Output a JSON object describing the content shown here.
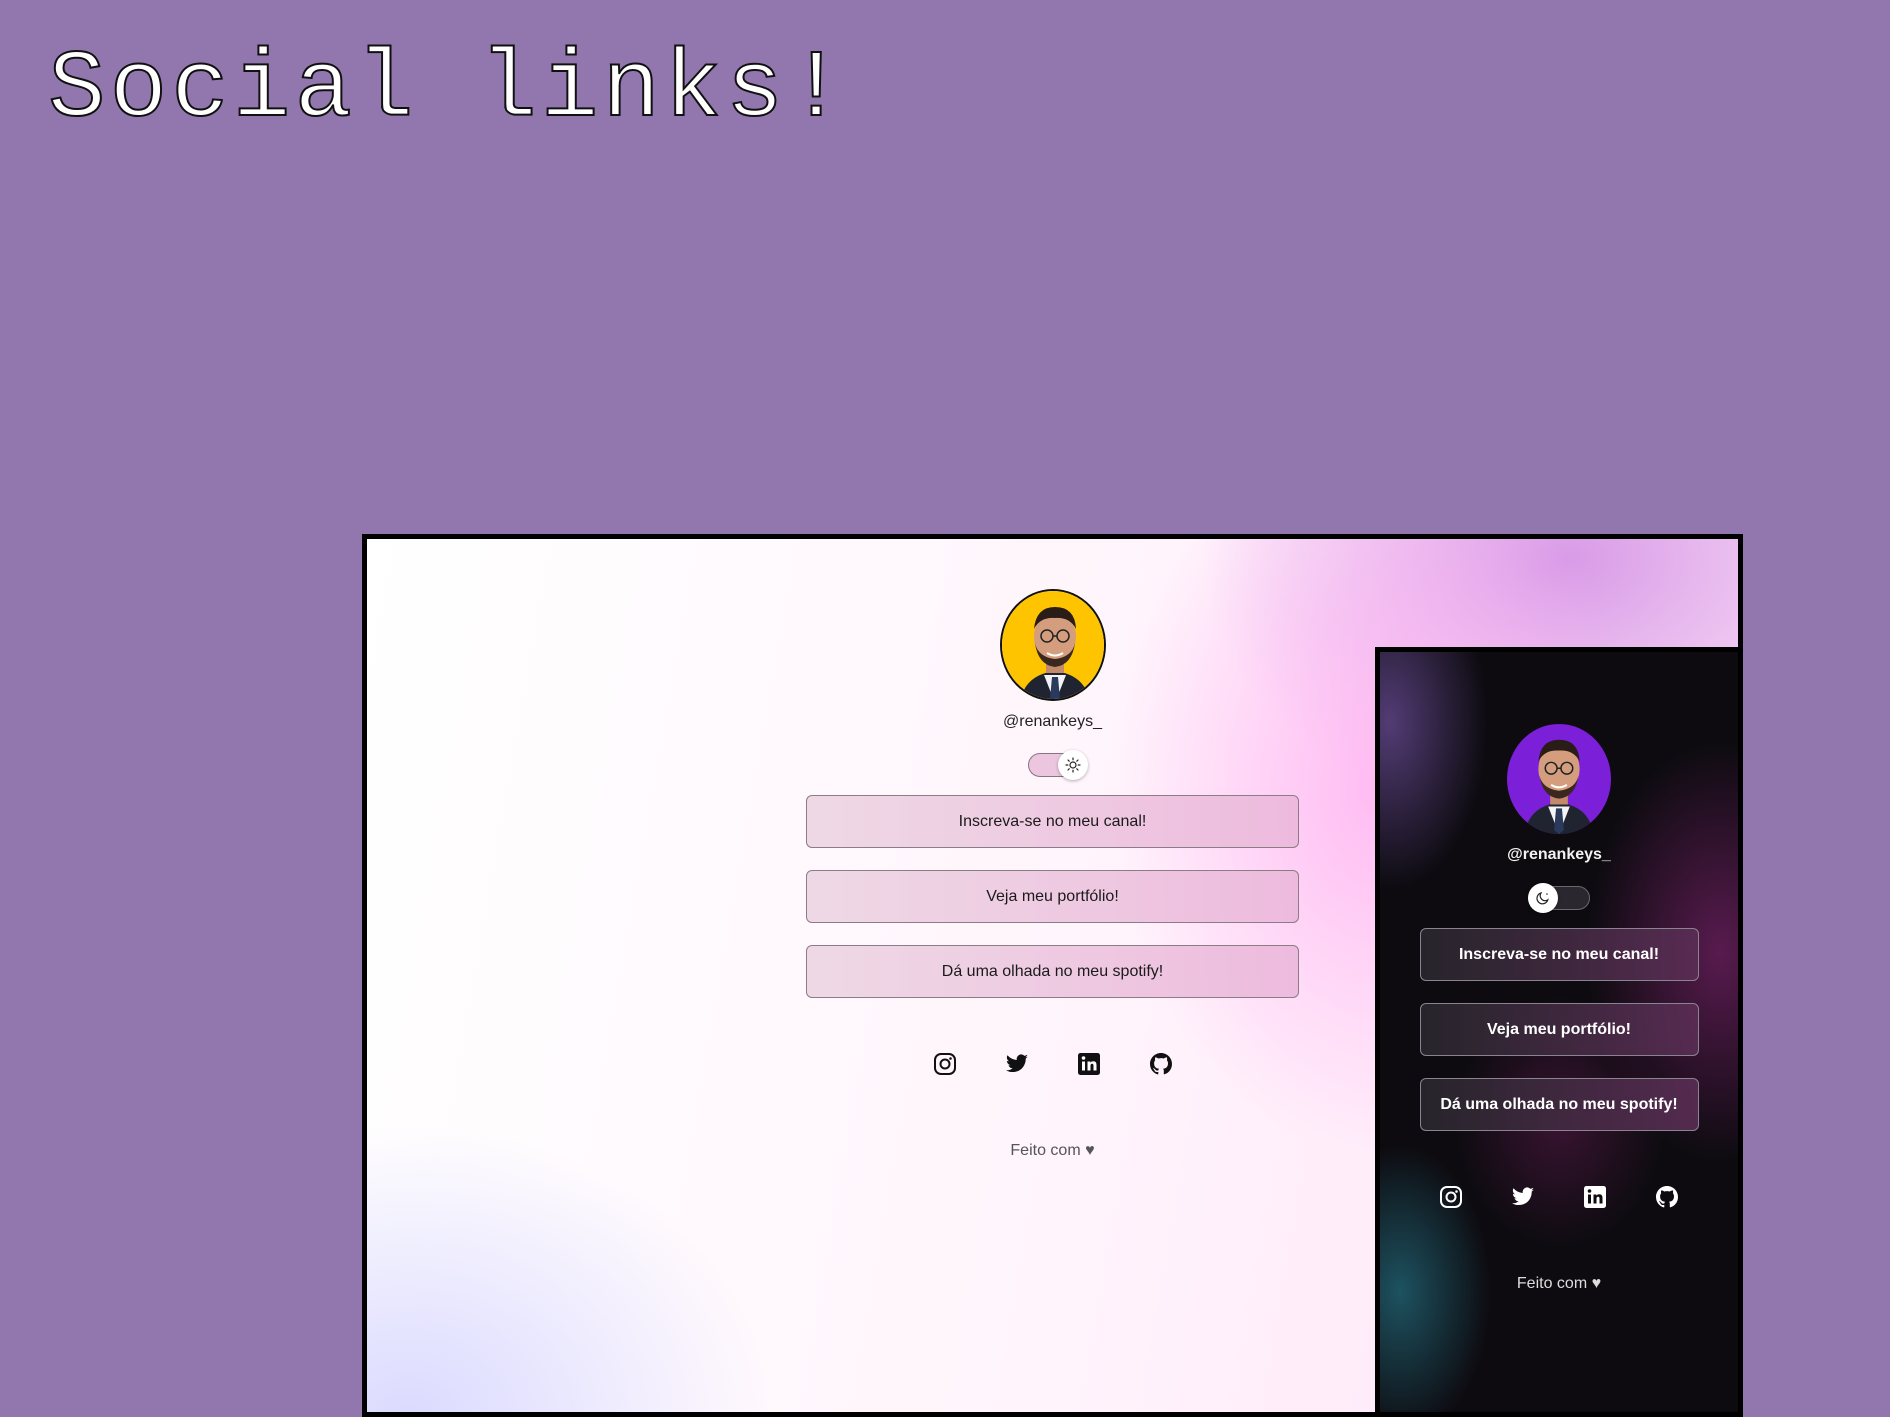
{
  "title": "Social links!",
  "light": {
    "handle": "@renankeys_",
    "links": [
      "Inscreva-se no meu canal!",
      "Veja meu portfólio!",
      "Dá uma olhada no meu spotify!"
    ],
    "footer": "Feito com ♥",
    "toggle_icon": "sun-icon",
    "avatar_bg": "#ffc400"
  },
  "dark": {
    "handle": "@renankeys_",
    "links": [
      "Inscreva-se no meu canal!",
      "Veja meu portfólio!",
      "Dá uma olhada no meu spotify!"
    ],
    "footer": "Feito com ♥",
    "toggle_icon": "moon-icon",
    "avatar_bg": "#7b1fd8"
  },
  "social_icons": [
    "instagram-icon",
    "twitter-icon",
    "linkedin-icon",
    "github-icon"
  ]
}
